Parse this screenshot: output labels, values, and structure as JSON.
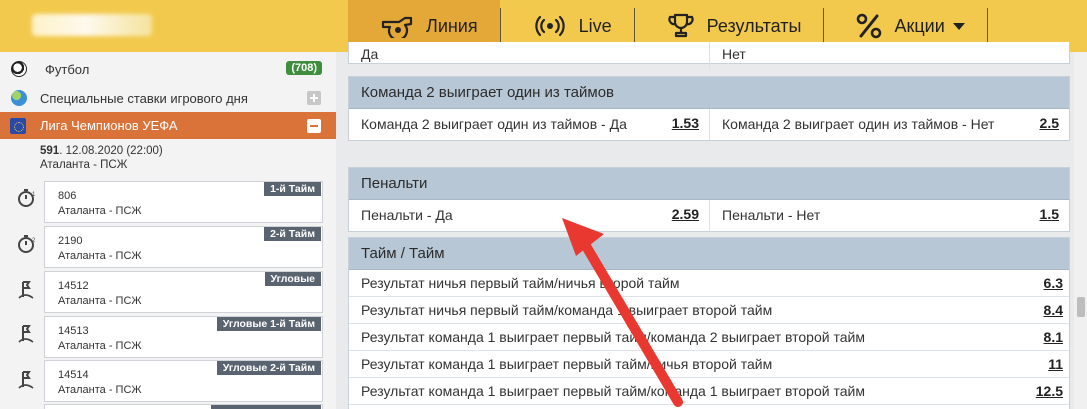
{
  "nav": {
    "items": [
      {
        "label": "Линия",
        "icon": "whistle-icon",
        "active": true
      },
      {
        "label": "Live",
        "icon": "live-broadcast-icon",
        "active": false
      },
      {
        "label": "Результаты",
        "icon": "trophy-icon",
        "active": false
      },
      {
        "label": "Акции",
        "icon": "percent-icon",
        "active": false
      }
    ]
  },
  "sidebar": {
    "football": {
      "label": "Футбол",
      "count": "(708)"
    },
    "special": {
      "label": "Специальные ставки игрового дня"
    },
    "league": {
      "label": "Лига Чемпионов УЕФА"
    },
    "match": {
      "number": "591",
      "date": ". 12.08.2020 (22:00)",
      "teams": "Аталанта - ПСЖ"
    },
    "events": [
      {
        "id": "806",
        "teams": "Аталанта - ПСЖ",
        "tag": "1-й Тайм",
        "icon": "stopwatch-1-icon"
      },
      {
        "id": "2190",
        "teams": "Аталанта - ПСЖ",
        "tag": "2-й Тайм",
        "icon": "stopwatch-2-icon"
      },
      {
        "id": "14512",
        "teams": "Аталанта - ПСЖ",
        "tag": "Угловые",
        "icon": "corner-flag-icon"
      },
      {
        "id": "14513",
        "teams": "Аталанта - ПСЖ",
        "tag": "Угловые 1-й Тайм",
        "icon": "corner-flag-icon"
      },
      {
        "id": "14514",
        "teams": "Аталанта - ПСЖ",
        "tag": "Угловые 2-й Тайм",
        "icon": "corner-flag-icon"
      }
    ]
  },
  "main": {
    "top_partial": {
      "left": "Да",
      "right": "Нет"
    },
    "block1": {
      "title": "Команда 2 выиграет один из таймов",
      "left_label": "Команда 2 выиграет один из таймов - Да",
      "left_odd": "1.53",
      "right_label": "Команда 2 выиграет один из таймов - Нет",
      "right_odd": "2.5"
    },
    "block2": {
      "title": "Пенальти",
      "left_label": "Пенальти - Да",
      "left_odd": "2.59",
      "right_label": "Пенальти - Нет",
      "right_odd": "1.5"
    },
    "block3": {
      "title": "Тайм / Тайм",
      "rows": [
        {
          "label": "Результат ничья первый тайм/ничья второй тайм",
          "odd": "6.3"
        },
        {
          "label": "Результат ничья первый тайм/команда 1 выиграет второй тайм",
          "odd": "8.4"
        },
        {
          "label": "Результат команда 1 выиграет первый тайм/команда 2 выиграет второй тайм",
          "odd": "8.1"
        },
        {
          "label": "Результат команда 1 выиграет первый тайм/ничья второй тайм",
          "odd": "11"
        },
        {
          "label": "Результат команда 1 выиграет первый тайм/команда 1 выиграет второй тайм",
          "odd": "12.5"
        }
      ]
    }
  },
  "colors": {
    "nav_bg": "#f2c94c",
    "nav_active": "#e3a837",
    "league_bg": "#d9733a",
    "block_head": "#b8c7d6",
    "badge": "#3e8e3e",
    "arrow": "#e8382f"
  }
}
